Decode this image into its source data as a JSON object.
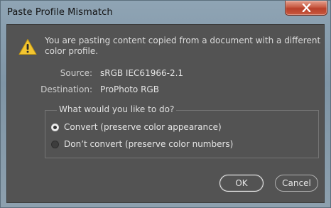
{
  "window": {
    "title": "Paste Profile Mismatch"
  },
  "dialog": {
    "message": "You are pasting content copied from a document with a different color profile.",
    "source_label": "Source:",
    "source_value": "sRGB IEC61966-2.1",
    "destination_label": "Destination:",
    "destination_value": "ProPhoto RGB",
    "group_label": "What would you like to do?",
    "options": [
      {
        "label": "Convert (preserve color appearance)",
        "selected": true
      },
      {
        "label": "Don’t convert (preserve color numbers)",
        "selected": false
      }
    ],
    "ok_label": "OK",
    "cancel_label": "Cancel"
  },
  "icons": {
    "warning": "warning-triangle-icon",
    "close": "close-icon"
  },
  "colors": {
    "dialog_background": "#535353",
    "warning_yellow": "#f3c530",
    "close_button_red": "#c85a43",
    "text": "#dcdcdc"
  }
}
